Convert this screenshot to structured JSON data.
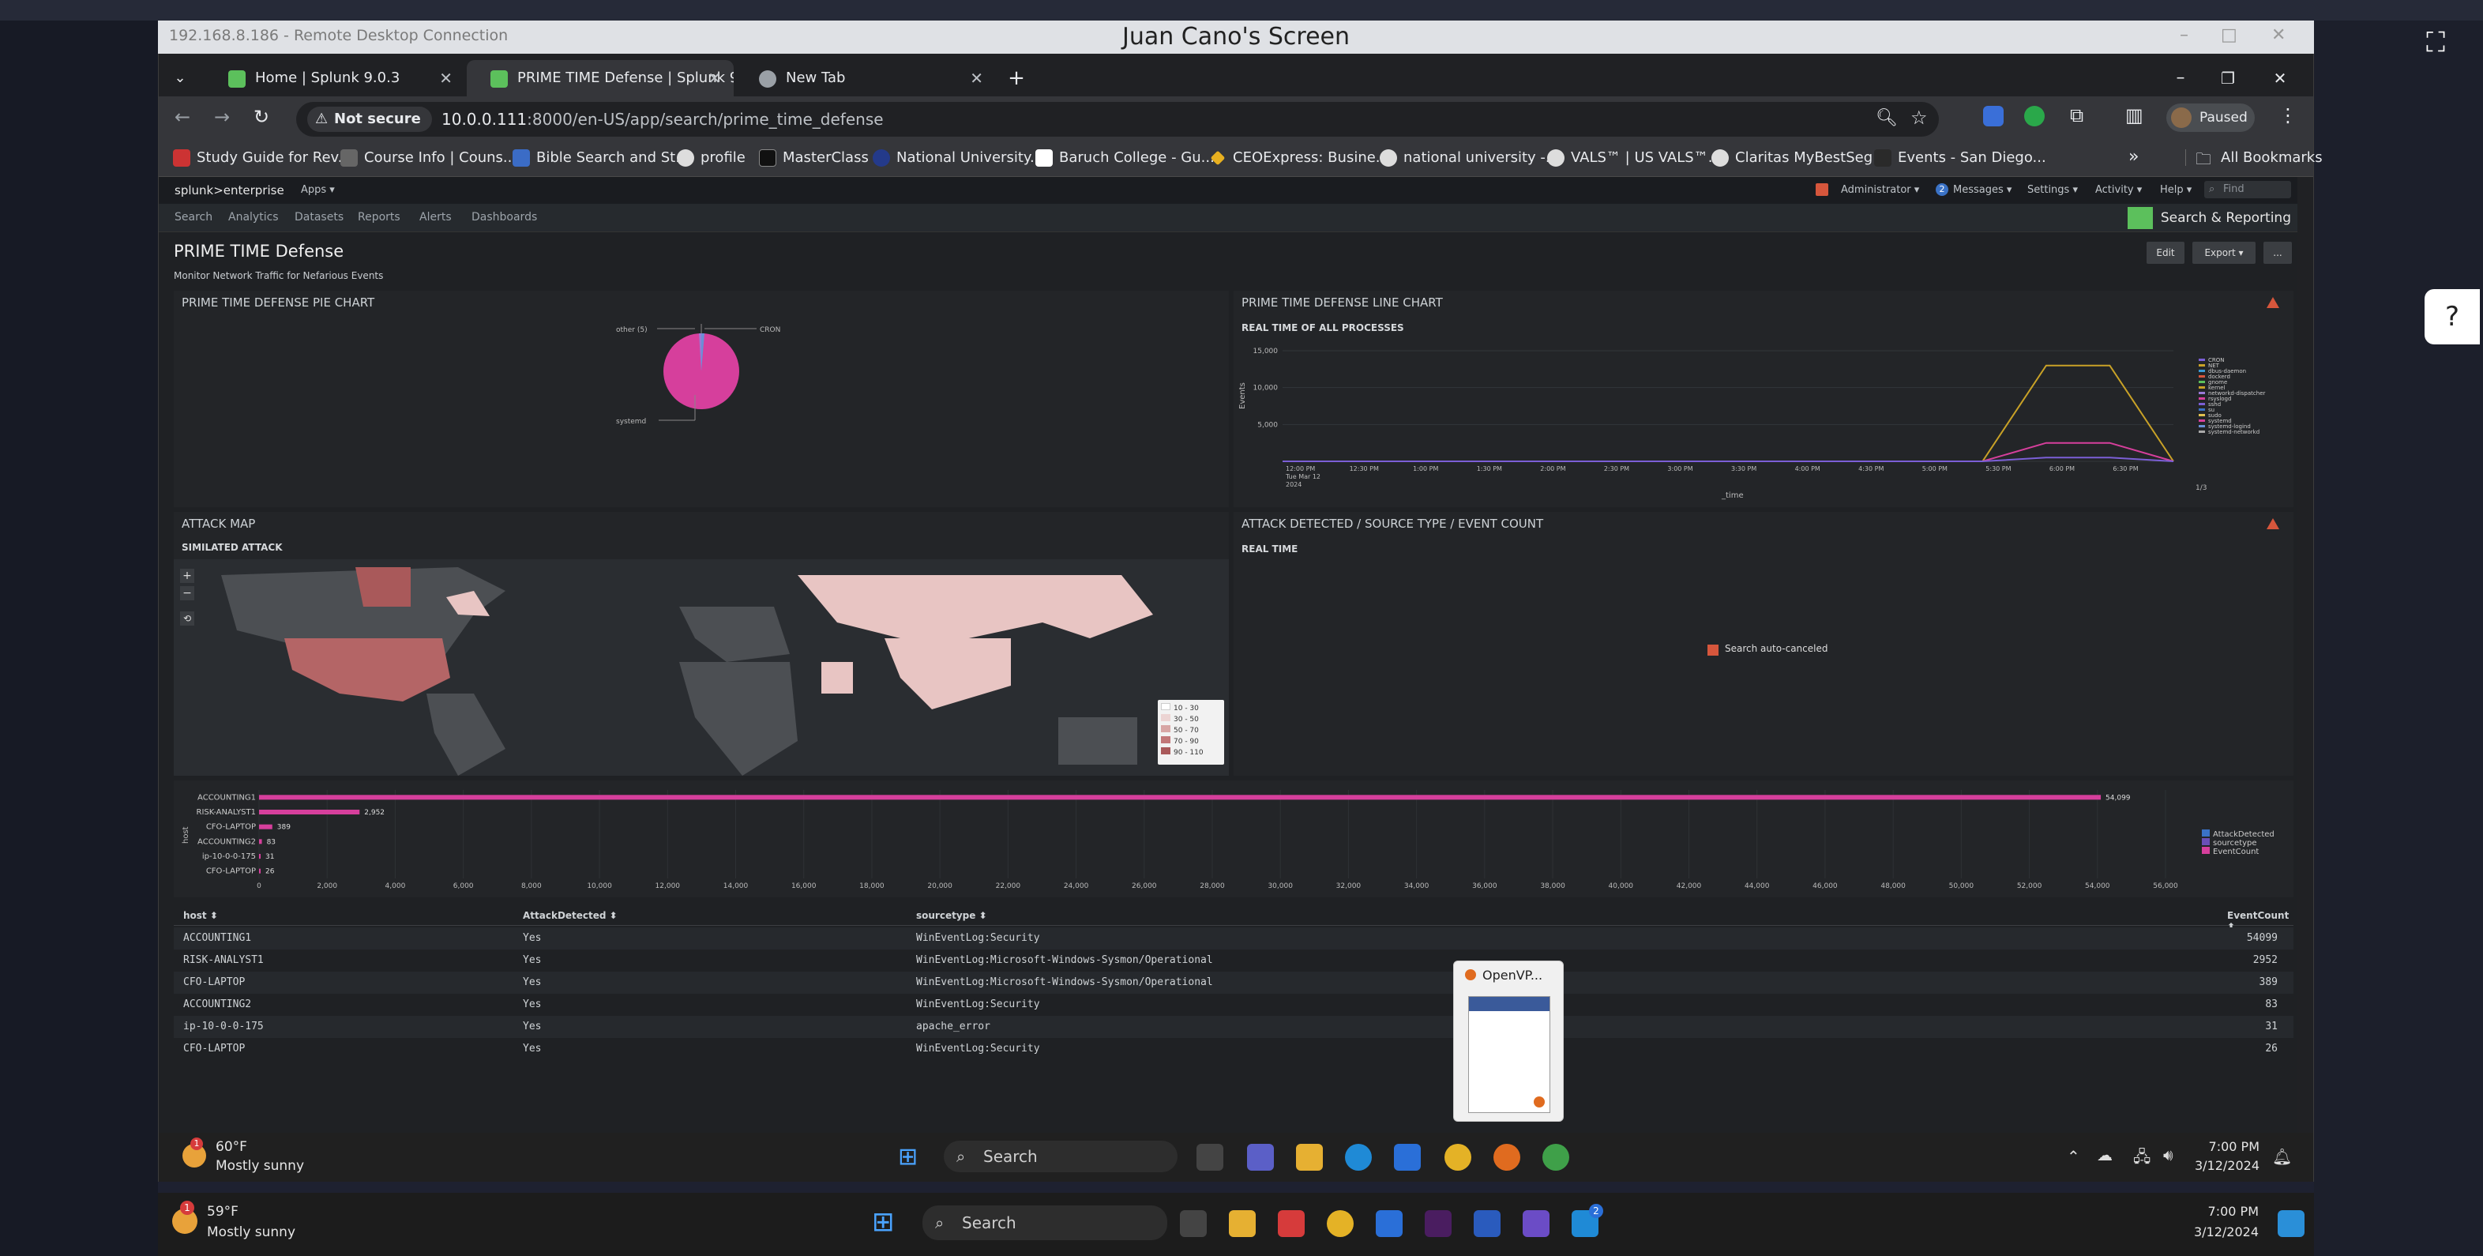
{
  "viewer_title": "Juan Cano's Screen",
  "rdc": {
    "title": "192.168.8.186 - Remote Desktop Connection",
    "controls": [
      "–",
      "□",
      "✕"
    ]
  },
  "browser": {
    "tabs": [
      {
        "label": "Home | Splunk 9.0.3",
        "active": false
      },
      {
        "label": "PRIME TIME Defense | Splunk 9",
        "active": true
      },
      {
        "label": "New Tab",
        "active": false
      }
    ],
    "not_secure": "Not secure",
    "url_host": "10.0.0.111",
    "url_rest": ":8000/en-US/app/search/prime_time_defense",
    "profile": "Paused",
    "bookmarks": [
      "Study Guide for Rev...",
      "Course Info | Couns...",
      "Bible Search and St...",
      "profile",
      "MasterClass",
      "National University...",
      "Baruch College - Gu...",
      "CEOExpress: Busine...",
      "national university -...",
      "VALS™ | US VALS™...",
      "Claritas MyBestSeg...",
      "Events - San Diego..."
    ],
    "all_bookmarks": "All Bookmarks"
  },
  "splunk": {
    "logo": "splunk>enterprise",
    "apps": "Apps ▾",
    "top_menu": [
      "Administrator ▾",
      "Messages ▾",
      "Settings ▾",
      "Activity ▾",
      "Help ▾"
    ],
    "messages_count": "2",
    "find_placeholder": "Find",
    "nav": [
      "Search",
      "Analytics",
      "Datasets",
      "Reports",
      "Alerts",
      "Dashboards"
    ],
    "app_name": "Search & Reporting",
    "dashboard_title": "PRIME TIME Defense",
    "dashboard_desc": "Monitor Network Traffic for Nefarious Events",
    "edit": "Edit",
    "export": "Export ▾",
    "more": "..."
  },
  "panels": {
    "pie": {
      "title": "PRIME TIME DEFENSE PIE CHART",
      "label_other": "other (5)",
      "label_cron": "CRON",
      "label_systemd": "systemd"
    },
    "line": {
      "title": "PRIME TIME DEFENSE LINE CHART",
      "subtitle": "REAL TIME of All Processes",
      "ylabel": "Events",
      "xlabel": "_time",
      "page": "1/3"
    },
    "map": {
      "title": "ATTACK MAP",
      "subtitle": "SIMILATED ATTACK",
      "legend": [
        "10 - 30",
        "30 - 50",
        "50 - 70",
        "70 - 90",
        "90 - 110"
      ]
    },
    "detected": {
      "title": "ATTACK DETECTED / SOURCE TYPE / EVENT COUNT",
      "subtitle": "REAL TIME",
      "message": "Search auto-canceled"
    },
    "bar": {
      "ylabel": "host",
      "legend": [
        "AttackDetected",
        "sourcetype",
        "EventCount"
      ]
    }
  },
  "chart_data": [
    {
      "type": "pie",
      "categories": [
        "systemd",
        "CRON",
        "other (5)"
      ],
      "values": [
        97,
        1,
        2
      ]
    },
    {
      "type": "line",
      "title": "REAL TIME of All Processes",
      "xlabel": "_time",
      "ylabel": "Events",
      "ylim": [
        0,
        15000
      ],
      "yticks": [
        "5,000",
        "10,000",
        "15,000"
      ],
      "x": [
        "12:00 PM\nTue Mar 12\n2024",
        "12:30 PM",
        "1:00 PM",
        "1:30 PM",
        "2:00 PM",
        "2:30 PM",
        "3:00 PM",
        "3:30 PM",
        "4:00 PM",
        "4:30 PM",
        "5:00 PM",
        "5:30 PM",
        "6:00 PM",
        "6:30 PM"
      ],
      "legend": [
        "CRON",
        "NET",
        "dbus-daemon",
        "dockerd",
        "gnome",
        "kernel",
        "networkd-dispatcher",
        "rsyslogd",
        "sshd",
        "su",
        "sudo",
        "systemd",
        "systemd-logind",
        "systemd-networkd"
      ],
      "series": [
        {
          "name": "kernel",
          "color": "#c9a227",
          "values": [
            0,
            0,
            0,
            0,
            0,
            0,
            0,
            0,
            0,
            0,
            0,
            0,
            13000,
            13000,
            0
          ]
        },
        {
          "name": "systemd",
          "color": "#d63f9c",
          "values": [
            0,
            0,
            0,
            0,
            0,
            0,
            0,
            0,
            0,
            0,
            0,
            0,
            2500,
            2500,
            0
          ]
        },
        {
          "name": "sshd",
          "color": "#7b5fd6",
          "values": [
            0,
            0,
            0,
            0,
            0,
            0,
            0,
            0,
            0,
            0,
            0,
            0,
            500,
            500,
            0
          ]
        }
      ]
    },
    {
      "type": "bar",
      "orientation": "horizontal",
      "categories": [
        "ACCOUNTING1",
        "RISK-ANALYST1",
        "CFO-LAPTOP",
        "ACCOUNTING2",
        "ip-10-0-0-175",
        "CFO-LAPTOP"
      ],
      "values": [
        54099,
        2952,
        389,
        83,
        31,
        26
      ],
      "data_labels": [
        "54,099",
        "2,952",
        "389",
        "83",
        "31",
        "26"
      ],
      "xlim": [
        0,
        56000
      ],
      "xticks": [
        "0",
        "2,000",
        "4,000",
        "6,000",
        "8,000",
        "10,000",
        "12,000",
        "14,000",
        "16,000",
        "18,000",
        "20,000",
        "22,000",
        "24,000",
        "26,000",
        "28,000",
        "30,000",
        "32,000",
        "34,000",
        "36,000",
        "38,000",
        "40,000",
        "42,000",
        "44,000",
        "46,000",
        "48,000",
        "50,000",
        "52,000",
        "54,000",
        "56,000"
      ],
      "ylabel": "host",
      "legend": [
        "AttackDetected",
        "sourcetype",
        "EventCount"
      ]
    }
  ],
  "table": {
    "headers": [
      "host ⬍",
      "AttackDetected ⬍",
      "sourcetype ⬍",
      "EventCount ⬍"
    ],
    "rows": [
      [
        "ACCOUNTING1",
        "Yes",
        "WinEventLog:Security",
        "54099"
      ],
      [
        "RISK-ANALYST1",
        "Yes",
        "WinEventLog:Microsoft-Windows-Sysmon/Operational",
        "2952"
      ],
      [
        "CFO-LAPTOP",
        "Yes",
        "WinEventLog:Microsoft-Windows-Sysmon/Operational",
        "389"
      ],
      [
        "ACCOUNTING2",
        "Yes",
        "WinEventLog:Security",
        "83"
      ],
      [
        "ip-10-0-0-175",
        "Yes",
        "apache_error",
        "31"
      ],
      [
        "CFO-LAPTOP",
        "Yes",
        "WinEventLog:Security",
        "26"
      ]
    ]
  },
  "thumb_label": "OpenVP...",
  "taskbar_inner": {
    "temp": "60°F",
    "weather": "Mostly sunny",
    "search": "Search",
    "time": "7:00 PM",
    "date": "3/12/2024"
  },
  "taskbar_outer": {
    "temp": "59°F",
    "weather": "Mostly sunny",
    "search": "Search",
    "time": "7:00 PM",
    "date": "3/12/2024",
    "badge": "2"
  },
  "colors": {
    "splunk_green": "#5cc05c",
    "pink": "#d63f9c",
    "map_fill": "#e8c5c3",
    "accent": "#c74a4a"
  }
}
